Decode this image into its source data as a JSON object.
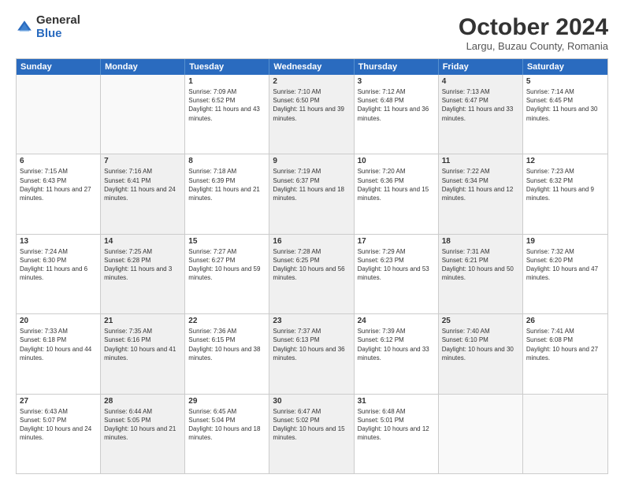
{
  "logo": {
    "general": "General",
    "blue": "Blue"
  },
  "header": {
    "month": "October 2024",
    "location": "Largu, Buzau County, Romania"
  },
  "days": [
    "Sunday",
    "Monday",
    "Tuesday",
    "Wednesday",
    "Thursday",
    "Friday",
    "Saturday"
  ],
  "weeks": [
    [
      {
        "day": "",
        "sunrise": "",
        "sunset": "",
        "daylight": "",
        "shaded": false,
        "empty": true
      },
      {
        "day": "",
        "sunrise": "",
        "sunset": "",
        "daylight": "",
        "shaded": false,
        "empty": true
      },
      {
        "day": "1",
        "sunrise": "Sunrise: 7:09 AM",
        "sunset": "Sunset: 6:52 PM",
        "daylight": "Daylight: 11 hours and 43 minutes.",
        "shaded": false,
        "empty": false
      },
      {
        "day": "2",
        "sunrise": "Sunrise: 7:10 AM",
        "sunset": "Sunset: 6:50 PM",
        "daylight": "Daylight: 11 hours and 39 minutes.",
        "shaded": true,
        "empty": false
      },
      {
        "day": "3",
        "sunrise": "Sunrise: 7:12 AM",
        "sunset": "Sunset: 6:48 PM",
        "daylight": "Daylight: 11 hours and 36 minutes.",
        "shaded": false,
        "empty": false
      },
      {
        "day": "4",
        "sunrise": "Sunrise: 7:13 AM",
        "sunset": "Sunset: 6:47 PM",
        "daylight": "Daylight: 11 hours and 33 minutes.",
        "shaded": true,
        "empty": false
      },
      {
        "day": "5",
        "sunrise": "Sunrise: 7:14 AM",
        "sunset": "Sunset: 6:45 PM",
        "daylight": "Daylight: 11 hours and 30 minutes.",
        "shaded": false,
        "empty": false
      }
    ],
    [
      {
        "day": "6",
        "sunrise": "Sunrise: 7:15 AM",
        "sunset": "Sunset: 6:43 PM",
        "daylight": "Daylight: 11 hours and 27 minutes.",
        "shaded": false,
        "empty": false
      },
      {
        "day": "7",
        "sunrise": "Sunrise: 7:16 AM",
        "sunset": "Sunset: 6:41 PM",
        "daylight": "Daylight: 11 hours and 24 minutes.",
        "shaded": true,
        "empty": false
      },
      {
        "day": "8",
        "sunrise": "Sunrise: 7:18 AM",
        "sunset": "Sunset: 6:39 PM",
        "daylight": "Daylight: 11 hours and 21 minutes.",
        "shaded": false,
        "empty": false
      },
      {
        "day": "9",
        "sunrise": "Sunrise: 7:19 AM",
        "sunset": "Sunset: 6:37 PM",
        "daylight": "Daylight: 11 hours and 18 minutes.",
        "shaded": true,
        "empty": false
      },
      {
        "day": "10",
        "sunrise": "Sunrise: 7:20 AM",
        "sunset": "Sunset: 6:36 PM",
        "daylight": "Daylight: 11 hours and 15 minutes.",
        "shaded": false,
        "empty": false
      },
      {
        "day": "11",
        "sunrise": "Sunrise: 7:22 AM",
        "sunset": "Sunset: 6:34 PM",
        "daylight": "Daylight: 11 hours and 12 minutes.",
        "shaded": true,
        "empty": false
      },
      {
        "day": "12",
        "sunrise": "Sunrise: 7:23 AM",
        "sunset": "Sunset: 6:32 PM",
        "daylight": "Daylight: 11 hours and 9 minutes.",
        "shaded": false,
        "empty": false
      }
    ],
    [
      {
        "day": "13",
        "sunrise": "Sunrise: 7:24 AM",
        "sunset": "Sunset: 6:30 PM",
        "daylight": "Daylight: 11 hours and 6 minutes.",
        "shaded": false,
        "empty": false
      },
      {
        "day": "14",
        "sunrise": "Sunrise: 7:25 AM",
        "sunset": "Sunset: 6:28 PM",
        "daylight": "Daylight: 11 hours and 3 minutes.",
        "shaded": true,
        "empty": false
      },
      {
        "day": "15",
        "sunrise": "Sunrise: 7:27 AM",
        "sunset": "Sunset: 6:27 PM",
        "daylight": "Daylight: 10 hours and 59 minutes.",
        "shaded": false,
        "empty": false
      },
      {
        "day": "16",
        "sunrise": "Sunrise: 7:28 AM",
        "sunset": "Sunset: 6:25 PM",
        "daylight": "Daylight: 10 hours and 56 minutes.",
        "shaded": true,
        "empty": false
      },
      {
        "day": "17",
        "sunrise": "Sunrise: 7:29 AM",
        "sunset": "Sunset: 6:23 PM",
        "daylight": "Daylight: 10 hours and 53 minutes.",
        "shaded": false,
        "empty": false
      },
      {
        "day": "18",
        "sunrise": "Sunrise: 7:31 AM",
        "sunset": "Sunset: 6:21 PM",
        "daylight": "Daylight: 10 hours and 50 minutes.",
        "shaded": true,
        "empty": false
      },
      {
        "day": "19",
        "sunrise": "Sunrise: 7:32 AM",
        "sunset": "Sunset: 6:20 PM",
        "daylight": "Daylight: 10 hours and 47 minutes.",
        "shaded": false,
        "empty": false
      }
    ],
    [
      {
        "day": "20",
        "sunrise": "Sunrise: 7:33 AM",
        "sunset": "Sunset: 6:18 PM",
        "daylight": "Daylight: 10 hours and 44 minutes.",
        "shaded": false,
        "empty": false
      },
      {
        "day": "21",
        "sunrise": "Sunrise: 7:35 AM",
        "sunset": "Sunset: 6:16 PM",
        "daylight": "Daylight: 10 hours and 41 minutes.",
        "shaded": true,
        "empty": false
      },
      {
        "day": "22",
        "sunrise": "Sunrise: 7:36 AM",
        "sunset": "Sunset: 6:15 PM",
        "daylight": "Daylight: 10 hours and 38 minutes.",
        "shaded": false,
        "empty": false
      },
      {
        "day": "23",
        "sunrise": "Sunrise: 7:37 AM",
        "sunset": "Sunset: 6:13 PM",
        "daylight": "Daylight: 10 hours and 36 minutes.",
        "shaded": true,
        "empty": false
      },
      {
        "day": "24",
        "sunrise": "Sunrise: 7:39 AM",
        "sunset": "Sunset: 6:12 PM",
        "daylight": "Daylight: 10 hours and 33 minutes.",
        "shaded": false,
        "empty": false
      },
      {
        "day": "25",
        "sunrise": "Sunrise: 7:40 AM",
        "sunset": "Sunset: 6:10 PM",
        "daylight": "Daylight: 10 hours and 30 minutes.",
        "shaded": true,
        "empty": false
      },
      {
        "day": "26",
        "sunrise": "Sunrise: 7:41 AM",
        "sunset": "Sunset: 6:08 PM",
        "daylight": "Daylight: 10 hours and 27 minutes.",
        "shaded": false,
        "empty": false
      }
    ],
    [
      {
        "day": "27",
        "sunrise": "Sunrise: 6:43 AM",
        "sunset": "Sunset: 5:07 PM",
        "daylight": "Daylight: 10 hours and 24 minutes.",
        "shaded": false,
        "empty": false
      },
      {
        "day": "28",
        "sunrise": "Sunrise: 6:44 AM",
        "sunset": "Sunset: 5:05 PM",
        "daylight": "Daylight: 10 hours and 21 minutes.",
        "shaded": true,
        "empty": false
      },
      {
        "day": "29",
        "sunrise": "Sunrise: 6:45 AM",
        "sunset": "Sunset: 5:04 PM",
        "daylight": "Daylight: 10 hours and 18 minutes.",
        "shaded": false,
        "empty": false
      },
      {
        "day": "30",
        "sunrise": "Sunrise: 6:47 AM",
        "sunset": "Sunset: 5:02 PM",
        "daylight": "Daylight: 10 hours and 15 minutes.",
        "shaded": true,
        "empty": false
      },
      {
        "day": "31",
        "sunrise": "Sunrise: 6:48 AM",
        "sunset": "Sunset: 5:01 PM",
        "daylight": "Daylight: 10 hours and 12 minutes.",
        "shaded": false,
        "empty": false
      },
      {
        "day": "",
        "sunrise": "",
        "sunset": "",
        "daylight": "",
        "shaded": false,
        "empty": true
      },
      {
        "day": "",
        "sunrise": "",
        "sunset": "",
        "daylight": "",
        "shaded": false,
        "empty": true
      }
    ]
  ]
}
